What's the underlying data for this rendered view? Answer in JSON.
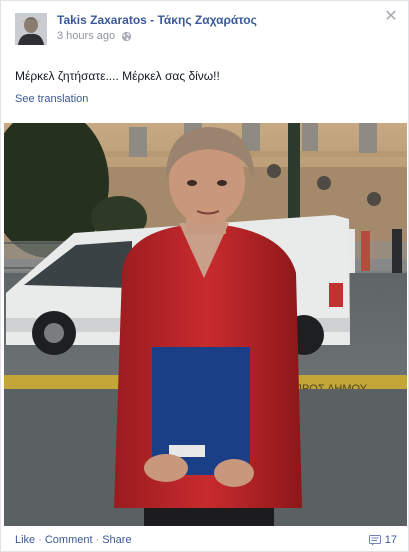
{
  "post": {
    "author": "Takis Zaxaratos - Τάκης Ζαχαράτος",
    "timestamp": "3 hours ago",
    "privacy_icon": "globe-icon",
    "text": "Μέρκελ ζητήσατε.... Μέρκελ σας δίνω!!",
    "see_translation": "See translation",
    "close_icon": "close-icon"
  },
  "photo": {
    "sign_text": "ΠΡΟΣ ΔΗΜΟΥ"
  },
  "footer": {
    "like": "Like",
    "comment": "Comment",
    "share": "Share",
    "separator": "·",
    "comment_count": "17",
    "comment_icon": "comment-bubble-icon"
  },
  "colors": {
    "link": "#3b5998",
    "muted": "#90949c",
    "text": "#141823"
  }
}
